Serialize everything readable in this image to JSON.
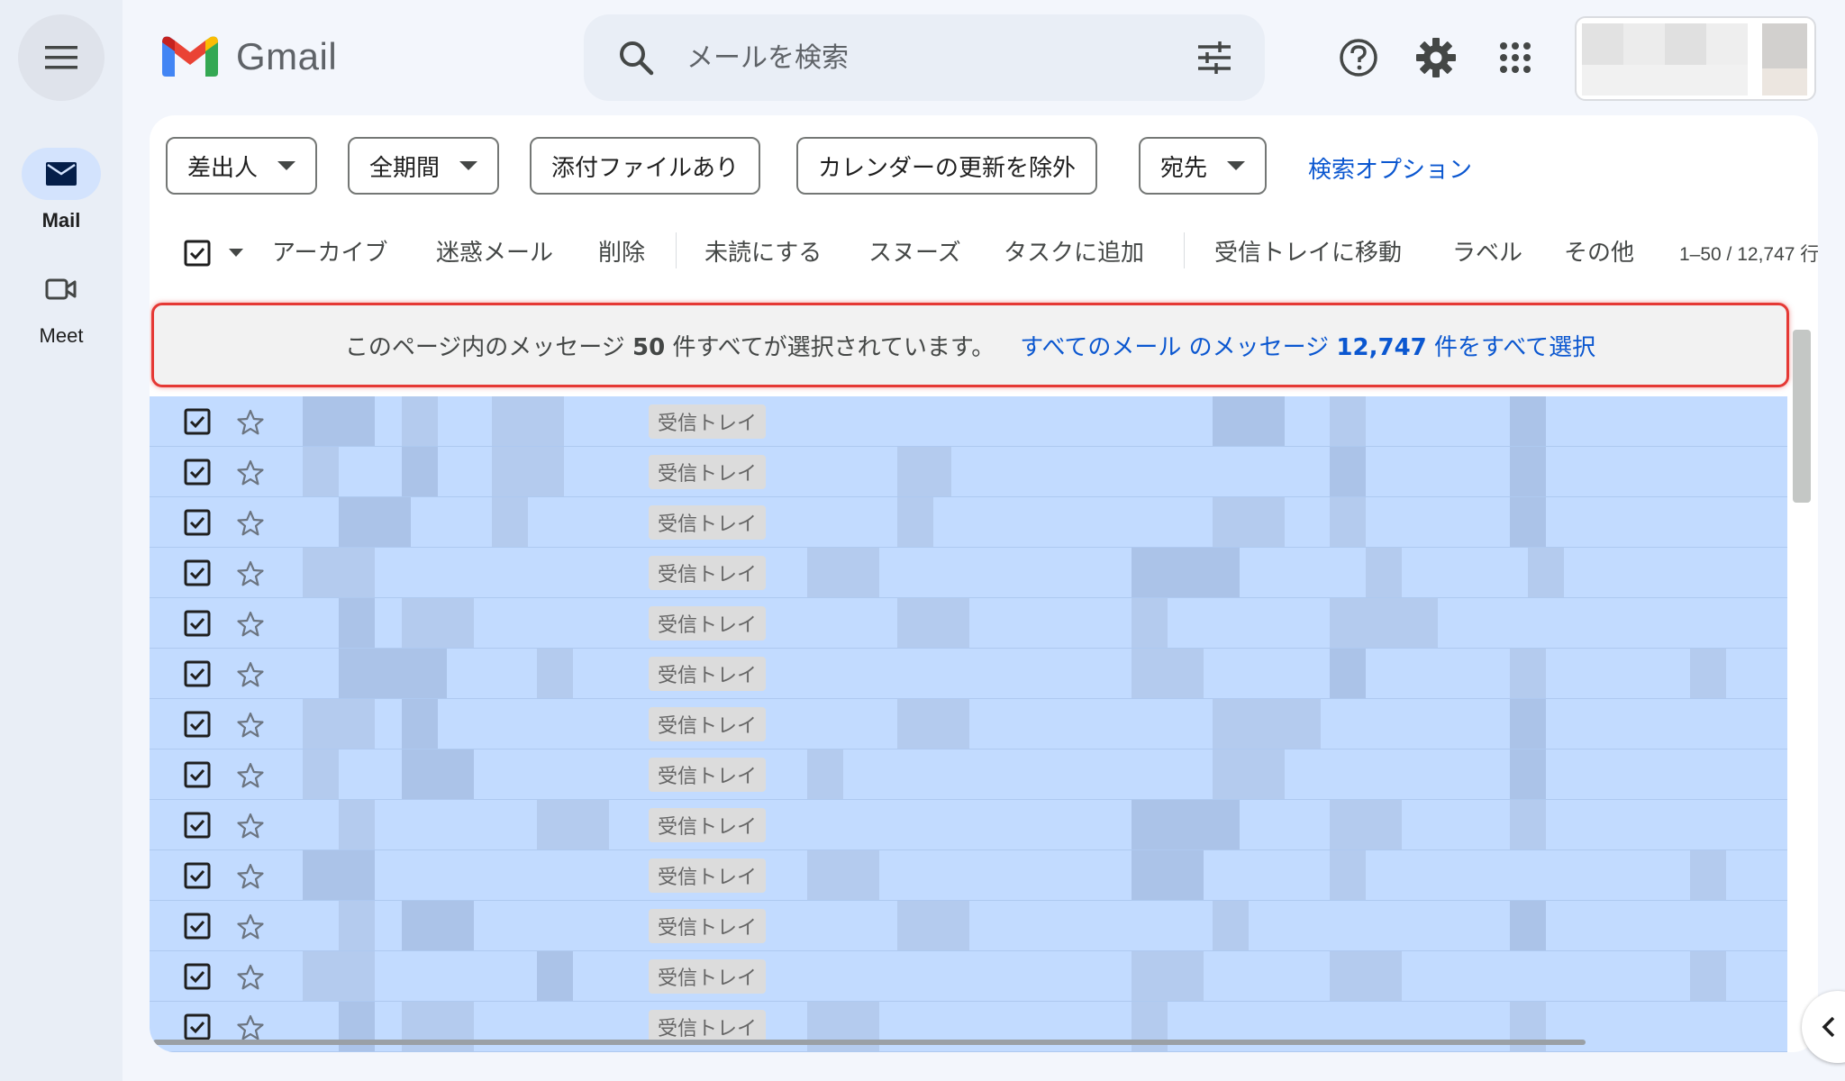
{
  "rail": {
    "mail_label": "Mail",
    "meet_label": "Meet"
  },
  "header": {
    "app_name": "Gmail",
    "search_placeholder": "メールを検索"
  },
  "filters": {
    "chips": [
      {
        "label": "差出人",
        "dropdown": true
      },
      {
        "label": "全期間",
        "dropdown": true
      },
      {
        "label": "添付ファイルあり",
        "dropdown": false
      },
      {
        "label": "カレンダーの更新を除外",
        "dropdown": false
      },
      {
        "label": "宛先",
        "dropdown": true
      }
    ],
    "advanced_link": "検索オプション"
  },
  "toolbar": {
    "actions": [
      "アーカイブ",
      "迷惑メール",
      "削除",
      "未読にする",
      "スヌーズ",
      "タスクに追加",
      "受信トレイに移動",
      "ラベル",
      "その他"
    ],
    "count": "1–50 / 12,747 行"
  },
  "banner": {
    "text_before": "このページ内のメッセージ ",
    "count": "50",
    "text_after": " 件すべてが選択されています。",
    "link_before": "すべてのメール のメッセージ ",
    "link_count": "12,747",
    "link_after": " 件をすべて選択"
  },
  "message_rows": [
    {
      "label": "受信トレイ",
      "selected": true
    },
    {
      "label": "受信トレイ",
      "selected": true
    },
    {
      "label": "受信トレイ",
      "selected": true
    },
    {
      "label": "受信トレイ",
      "selected": true
    },
    {
      "label": "受信トレイ",
      "selected": true
    },
    {
      "label": "受信トレイ",
      "selected": true
    },
    {
      "label": "受信トレイ",
      "selected": true
    },
    {
      "label": "受信トレイ",
      "selected": true
    },
    {
      "label": "受信トレイ",
      "selected": true
    },
    {
      "label": "受信トレイ",
      "selected": true
    },
    {
      "label": "受信トレイ",
      "selected": true
    },
    {
      "label": "受信トレイ",
      "selected": true
    },
    {
      "label": "受信トレイ",
      "selected": true
    }
  ],
  "colors": {
    "accent": "#0b57d0",
    "selected_row": "#c2dbff",
    "highlight_border": "#e53935"
  }
}
